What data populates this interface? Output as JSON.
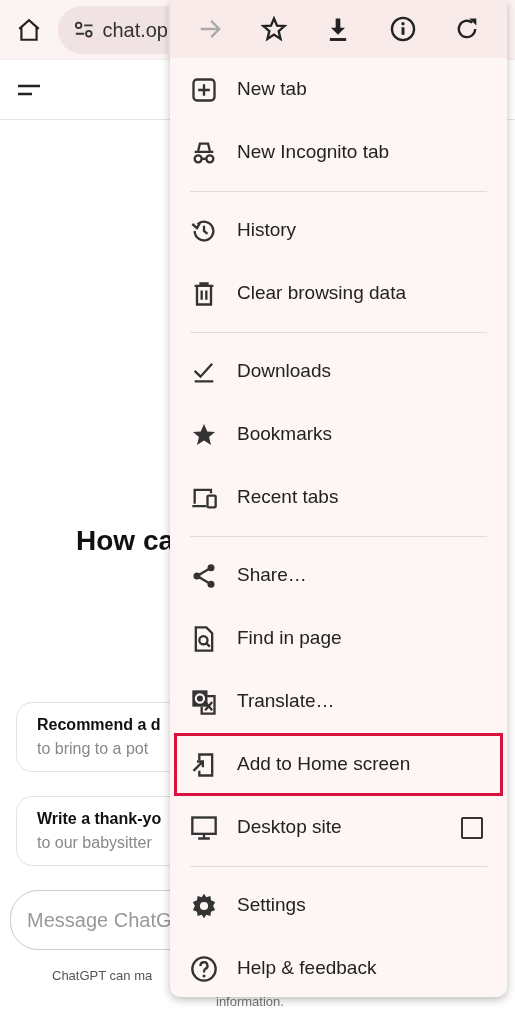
{
  "address_bar": {
    "url": "chat.op"
  },
  "page": {
    "heading": "How ca",
    "suggestions": [
      {
        "title": "Recommend a d",
        "subtitle": "to bring to a pot"
      },
      {
        "title": "Write a thank-yo",
        "subtitle": "to our babysitter"
      }
    ],
    "message_field": {
      "placeholder": "Message ChatG"
    },
    "disclaimer": "ChatGPT can ma",
    "disclaimer_2": "information."
  },
  "menu": {
    "toolbar": [
      {
        "disabled": true
      },
      {
        "disabled": false
      },
      {
        "disabled": false
      },
      {
        "disabled": false
      },
      {
        "disabled": false
      }
    ],
    "groups": [
      [
        {
          "kind": "item",
          "label": "New tab",
          "highlighted": false
        },
        {
          "kind": "item",
          "label": "New Incognito tab",
          "highlighted": false
        }
      ],
      [
        {
          "kind": "item",
          "label": "History",
          "highlighted": false
        },
        {
          "kind": "item",
          "label": "Clear browsing data",
          "highlighted": false
        }
      ],
      [
        {
          "kind": "item",
          "label": "Downloads",
          "highlighted": false
        },
        {
          "kind": "item",
          "label": "Bookmarks",
          "highlighted": false
        },
        {
          "kind": "item",
          "label": "Recent tabs",
          "highlighted": false
        }
      ],
      [
        {
          "kind": "item",
          "label": "Share…",
          "highlighted": false
        },
        {
          "kind": "item",
          "label": "Find in page",
          "highlighted": false
        },
        {
          "kind": "item",
          "label": "Translate…",
          "highlighted": false
        },
        {
          "kind": "item",
          "label": "Add to Home screen",
          "highlighted": true
        },
        {
          "kind": "checkbox",
          "label": "Desktop site",
          "highlighted": false,
          "checked": false
        }
      ],
      [
        {
          "kind": "item",
          "label": "Settings",
          "highlighted": false
        },
        {
          "kind": "item",
          "label": "Help & feedback",
          "highlighted": false
        }
      ]
    ]
  }
}
